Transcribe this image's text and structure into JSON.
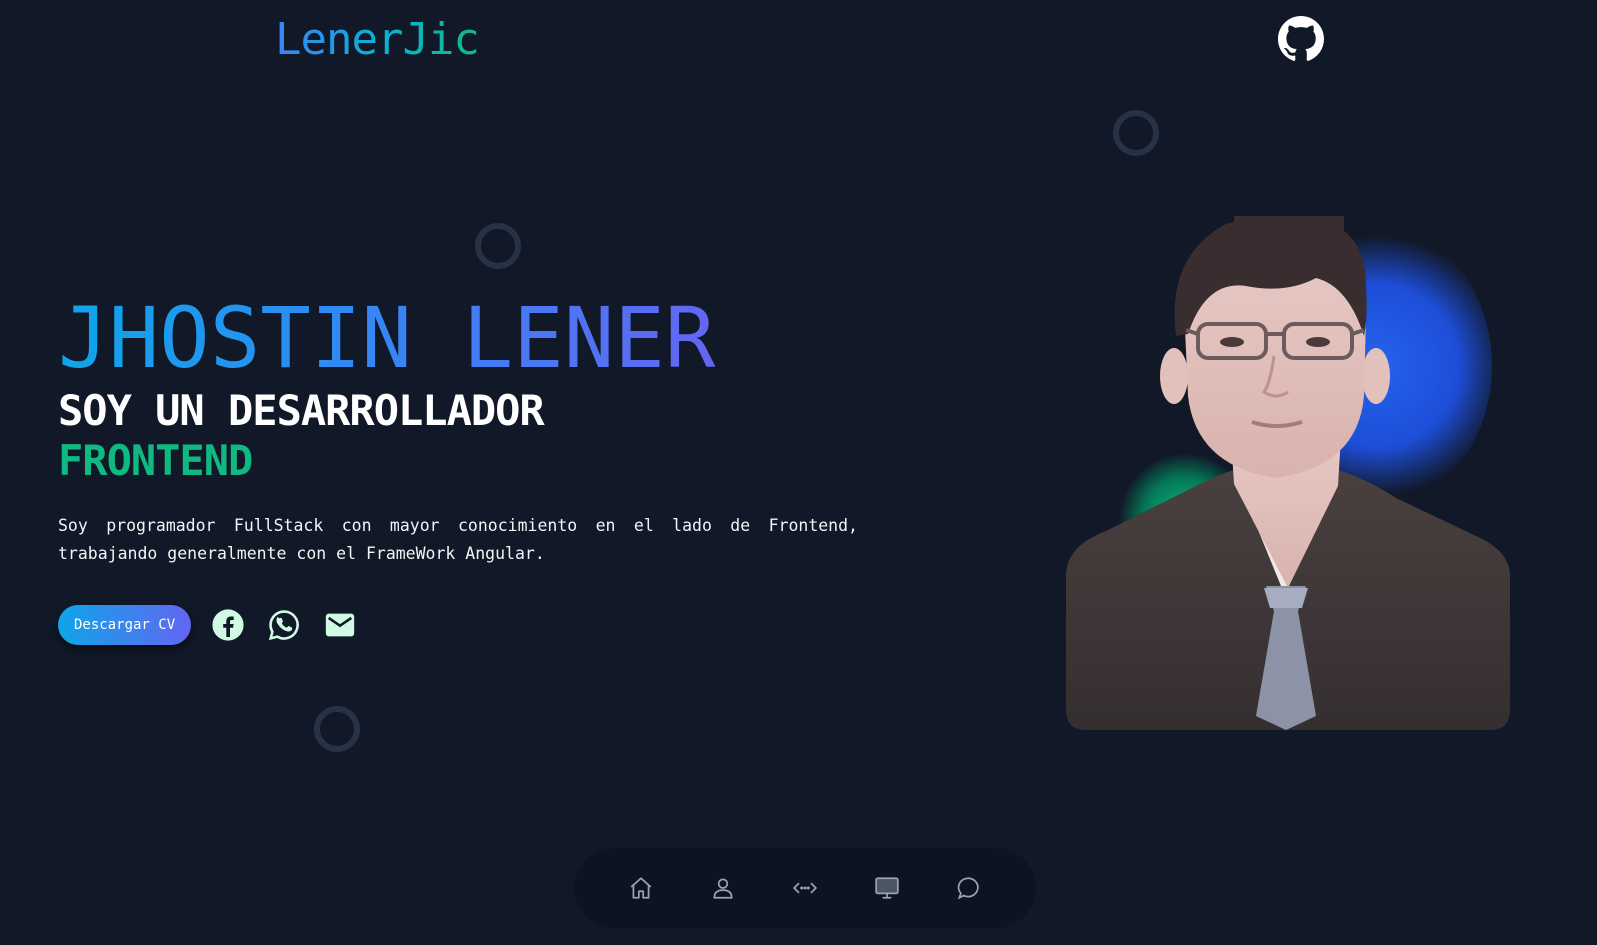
{
  "header": {
    "logo_text": "LenerJic",
    "github_icon": "github-icon"
  },
  "hero": {
    "name": "JHOSTIN LENER",
    "line1": "SOY UN DESARROLLADOR",
    "line2": "FRONTEND",
    "description": "Soy programador FullStack con mayor conocimiento en el lado de Frontend, trabajando generalmente con el FrameWork Angular.",
    "cv_button_label": "Descargar CV"
  },
  "social": [
    {
      "icon": "facebook-icon"
    },
    {
      "icon": "whatsapp-icon"
    },
    {
      "icon": "mail-icon"
    }
  ],
  "bottom_nav": [
    {
      "icon": "home-icon"
    },
    {
      "icon": "user-icon"
    },
    {
      "icon": "code-icon"
    },
    {
      "icon": "monitor-icon"
    },
    {
      "icon": "chat-icon"
    }
  ],
  "colors": {
    "background": "#111827",
    "accent_blue": "#3b82f6",
    "accent_green": "#10b981",
    "accent_indigo": "#6366f1"
  }
}
